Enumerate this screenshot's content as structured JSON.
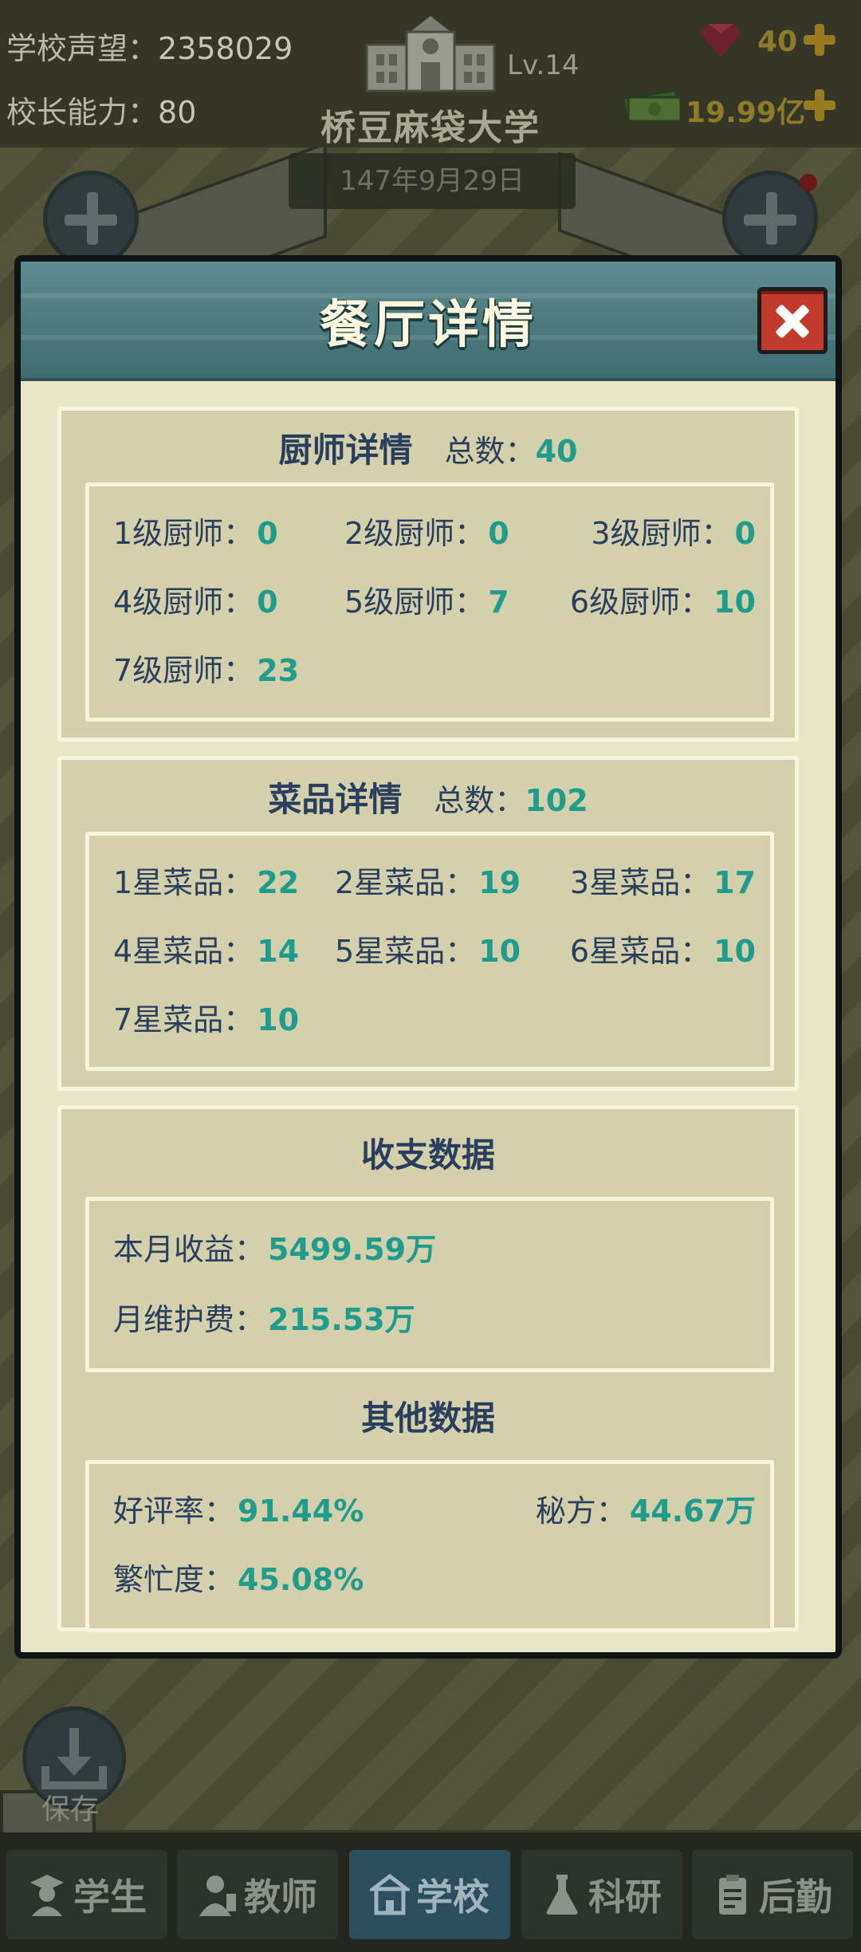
{
  "top": {
    "reputation_label": "学校声望：",
    "reputation_value": "2358029",
    "ability_label": "校长能力：",
    "ability_value": "80",
    "level": "Lv.14",
    "school_name": "桥豆麻袋大学",
    "date": "147年9月29日",
    "gems": "40",
    "money": "19.99亿"
  },
  "dialog": {
    "title": "餐厅详情",
    "chefs": {
      "title": "厨师详情",
      "total_label": "总数：",
      "total_value": "40",
      "items": [
        {
          "label": "1级厨师：",
          "value": "0"
        },
        {
          "label": "2级厨师：",
          "value": "0"
        },
        {
          "label": "3级厨师：",
          "value": "0"
        },
        {
          "label": "4级厨师：",
          "value": "0"
        },
        {
          "label": "5级厨师：",
          "value": "7"
        },
        {
          "label": "6级厨师：",
          "value": "10"
        },
        {
          "label": "7级厨师：",
          "value": "23"
        }
      ]
    },
    "dishes": {
      "title": "菜品详情",
      "total_label": "总数：",
      "total_value": "102",
      "items": [
        {
          "label": "1星菜品：",
          "value": "22"
        },
        {
          "label": "2星菜品：",
          "value": "19"
        },
        {
          "label": "3星菜品：",
          "value": "17"
        },
        {
          "label": "4星菜品：",
          "value": "14"
        },
        {
          "label": "5星菜品：",
          "value": "10"
        },
        {
          "label": "6星菜品：",
          "value": "10"
        },
        {
          "label": "7星菜品：",
          "value": "10"
        }
      ]
    },
    "finance": {
      "title": "收支数据",
      "income_label": "本月收益：",
      "income_value": "5499.59万",
      "upkeep_label": "月维护费：",
      "upkeep_value": "215.53万"
    },
    "other": {
      "title": "其他数据",
      "rating_label": "好评率：",
      "rating_value": "91.44%",
      "recipe_label": "秘方：",
      "recipe_value": "44.67万",
      "busy_label": "繁忙度：",
      "busy_value": "45.08%"
    }
  },
  "save_label": "保存",
  "tabs": [
    {
      "label": "学生",
      "icon": "student-icon"
    },
    {
      "label": "教师",
      "icon": "teacher-icon"
    },
    {
      "label": "学校",
      "icon": "school-icon"
    },
    {
      "label": "科研",
      "icon": "flask-icon"
    },
    {
      "label": "后勤",
      "icon": "clipboard-icon"
    }
  ],
  "colors": {
    "accent_value": "#1f9c8c",
    "header_teal": "#4b7a7d",
    "close_red": "#c23a2c",
    "panel_bg": "#e8e6c6",
    "text_dark": "#2a3f5e"
  }
}
